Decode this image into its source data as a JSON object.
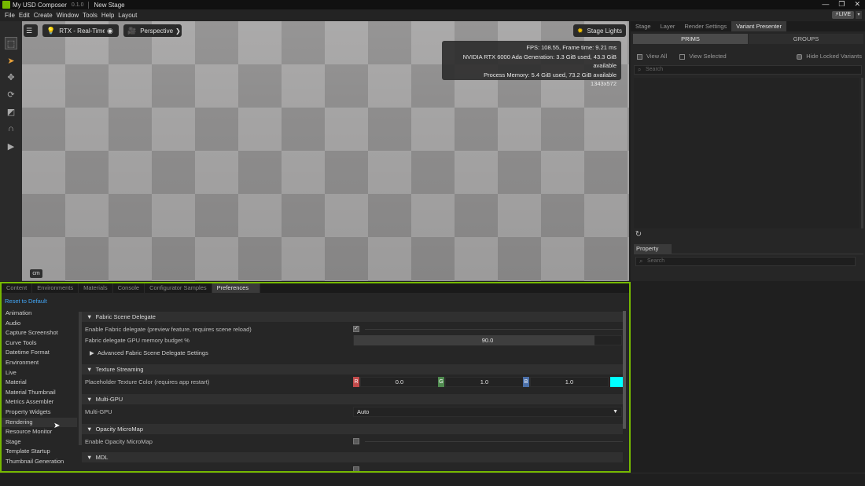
{
  "window": {
    "app_title": "My USD Composer",
    "version": "0.1.0",
    "stage_name": "New Stage",
    "live_label": "LIVE"
  },
  "menu": [
    "File",
    "Edit",
    "Create",
    "Window",
    "Tools",
    "Help",
    "Layout"
  ],
  "viewport": {
    "render_mode": "RTX - Real-Time",
    "camera": "Perspective",
    "stage_lights": "Stage Lights",
    "stats": [
      "FPS: 108.55, Frame time: 9.21 ms",
      "NVIDIA RTX 6000 Ada Generation: 3.3 GiB used, 43.3 GiB available",
      "Process Memory: 5.4 GiB used, 73.2 GiB available",
      "1343x572"
    ],
    "unit_badge": "cm"
  },
  "right_panel": {
    "tabs": [
      "Stage",
      "Layer",
      "Render Settings",
      "Variant Presenter"
    ],
    "active_tab": "Variant Presenter",
    "segments": [
      "PRIMS",
      "GROUPS"
    ],
    "view_all": "View All",
    "view_selected": "View Selected",
    "hide_locked": "Hide Locked Variants",
    "search_placeholder": "Search",
    "property_tab": "Property",
    "property_search_placeholder": "Search"
  },
  "bottom_panel": {
    "tabs": [
      "Content",
      "Environments",
      "Materials",
      "Console",
      "Configurator Samples",
      "Preferences"
    ],
    "active_tab": "Preferences",
    "reset_label": "Reset to Default",
    "categories": [
      "Animation",
      "Audio",
      "Capture Screenshot",
      "Curve Tools",
      "Datetime Format",
      "Environment",
      "Live",
      "Material",
      "Material Thumbnail",
      "Metrics Assembler",
      "Property Widgets",
      "Rendering",
      "Resource Monitor",
      "Stage",
      "Template Startup",
      "Thumbnail Generation"
    ],
    "active_category": "Rendering",
    "sections": {
      "fabric": {
        "title": "Fabric Scene Delegate",
        "enable_label": "Enable Fabric delegate (preview feature, requires scene reload)",
        "budget_label": "Fabric delegate GPU memory budget %",
        "budget_value": "90.0",
        "budget_fraction": 0.9,
        "advanced": "Advanced Fabric Scene Delegate Settings"
      },
      "texture": {
        "title": "Texture Streaming",
        "placeholder_label": "Placeholder Texture Color (requires app restart)",
        "r_label": "R",
        "r_value": "0.0",
        "g_label": "G",
        "g_value": "1.0",
        "b_label": "B",
        "b_value": "1.0",
        "swatch_color": "#00ffff"
      },
      "multigpu": {
        "title": "Multi-GPU",
        "label": "Multi-GPU",
        "value": "Auto"
      },
      "opacity": {
        "title": "Opacity MicroMap",
        "label": "Enable Opacity MicroMap"
      },
      "mdl": {
        "title": "MDL"
      }
    }
  },
  "colors": {
    "accent": "#76b900",
    "link": "#42a5f5",
    "swatch": "#00ffff"
  }
}
